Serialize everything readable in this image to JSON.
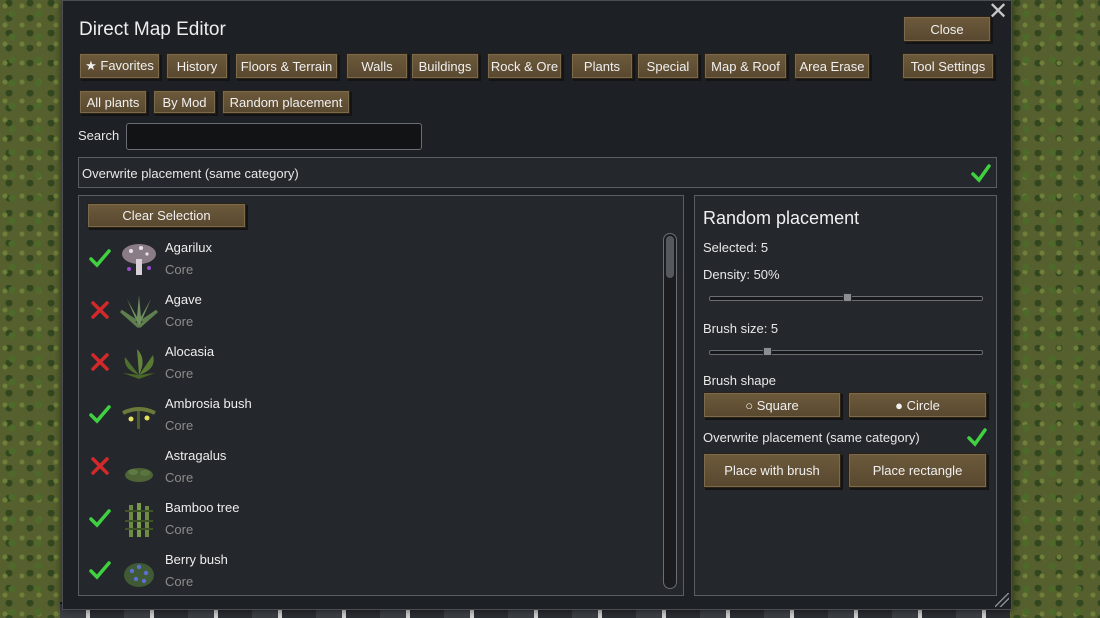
{
  "window": {
    "title": "Direct Map Editor",
    "close_label": "Close"
  },
  "tabs": [
    {
      "label": "★ Favorites"
    },
    {
      "label": "History"
    },
    {
      "label": "Floors & Terrain"
    },
    {
      "label": "Walls"
    },
    {
      "label": "Buildings"
    },
    {
      "label": "Rock & Ore"
    },
    {
      "label": "Plants"
    },
    {
      "label": "Special"
    },
    {
      "label": "Map & Roof"
    },
    {
      "label": "Area Erase"
    }
  ],
  "tool_settings_label": "Tool Settings",
  "subtabs": [
    {
      "label": "All plants"
    },
    {
      "label": "By Mod"
    },
    {
      "label": "Random placement"
    }
  ],
  "search": {
    "label": "Search",
    "value": "",
    "placeholder": ""
  },
  "overwrite": {
    "label": "Overwrite placement (same category)",
    "checked": true
  },
  "list": {
    "clear_label": "Clear Selection",
    "items": [
      {
        "name": "Agarilux",
        "mod": "Core",
        "selected": true,
        "icon": "mushroom-icon"
      },
      {
        "name": "Agave",
        "mod": "Core",
        "selected": false,
        "icon": "agave-icon"
      },
      {
        "name": "Alocasia",
        "mod": "Core",
        "selected": false,
        "icon": "leaf-plant-icon"
      },
      {
        "name": "Ambrosia bush",
        "mod": "Core",
        "selected": true,
        "icon": "bush-icon"
      },
      {
        "name": "Astragalus",
        "mod": "Core",
        "selected": false,
        "icon": "shrub-icon"
      },
      {
        "name": "Bamboo tree",
        "mod": "Core",
        "selected": true,
        "icon": "bamboo-icon"
      },
      {
        "name": "Berry bush",
        "mod": "Core",
        "selected": true,
        "icon": "berry-bush-icon"
      }
    ]
  },
  "random": {
    "title": "Random placement",
    "selected": "Selected: 5",
    "density_label": "Density: 50%",
    "density_value": 0.5,
    "brush_size_label": "Brush size: 5",
    "brush_size_value": 0.2,
    "brush_shape_label": "Brush shape",
    "square_label": "○ Square",
    "circle_label": "● Circle",
    "overwrite_label": "Overwrite placement (same category)",
    "overwrite_checked": true,
    "place_brush_label": "Place with brush",
    "place_rect_label": "Place rectangle"
  },
  "colors": {
    "accent_button": "#5f4e33",
    "check_green": "#3fd13f",
    "cross_red": "#d22a2a"
  }
}
